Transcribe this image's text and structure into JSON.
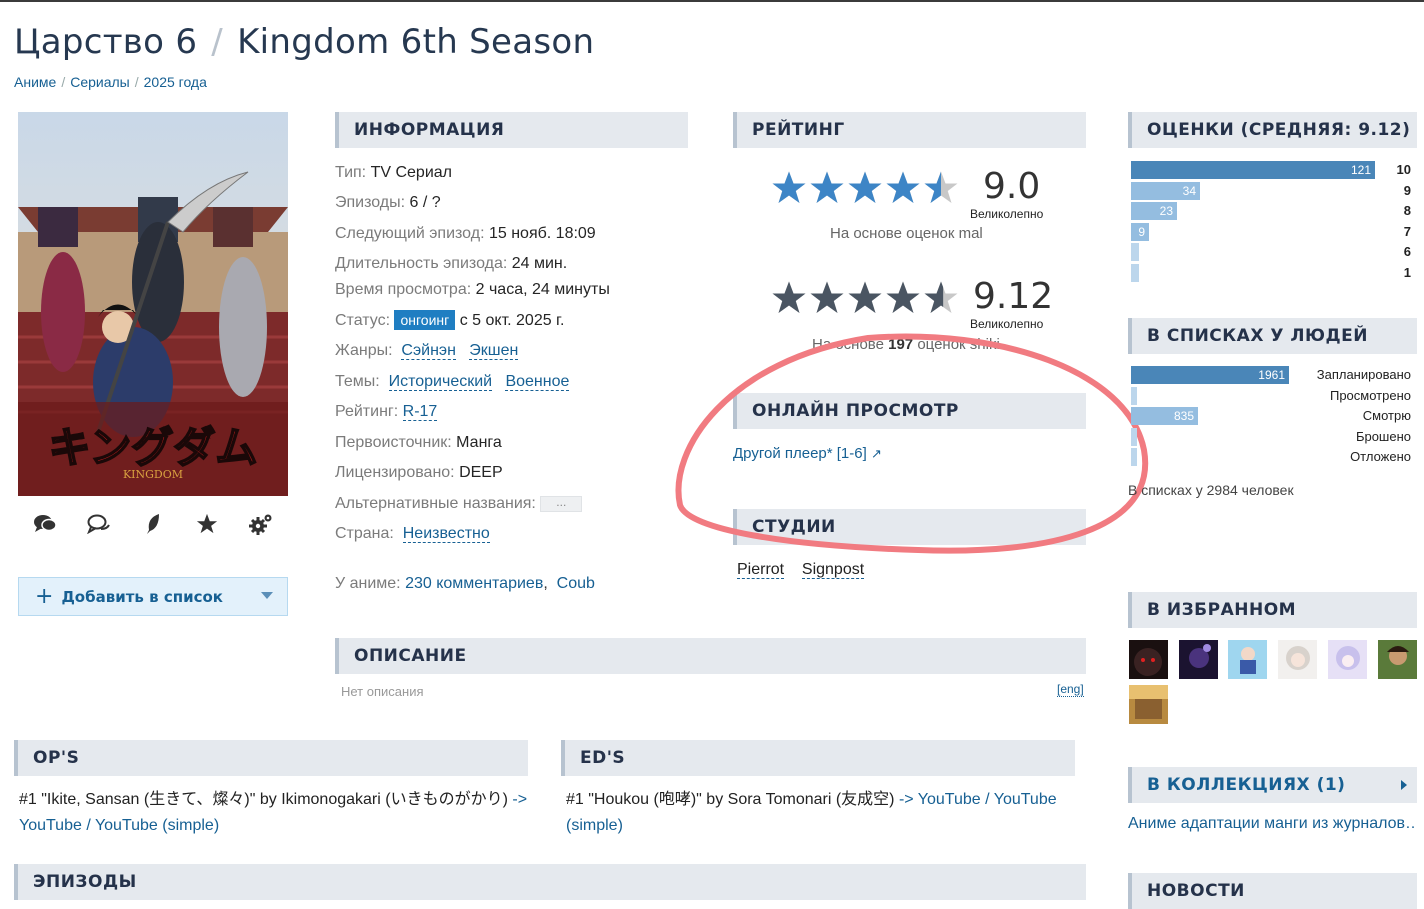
{
  "title": {
    "ru": "Царство 6",
    "separator": "/",
    "en": "Kingdom 6th Season"
  },
  "breadcrumbs": [
    "Аниме",
    "Сериалы",
    "2025 года"
  ],
  "poster": {
    "logo_text": "キングダム",
    "logo_sub": "KINGDOM"
  },
  "actions": {
    "add_to_list": "Добавить в список",
    "plus": "+"
  },
  "sections": {
    "info": "ИНФОРМАЦИЯ",
    "rating": "РЕЙТИНГ",
    "scores": "ОЦЕНКИ (СРЕДНЯЯ: 9.12)",
    "in_lists": "В СПИСКАХ У ЛЮДЕЙ",
    "online": "ОНЛАЙН ПРОСМОТР",
    "studios": "СТУДИИ",
    "favorites": "В ИЗБРАННОМ",
    "description": "ОПИСАНИЕ",
    "ops": "OP'S",
    "eds": "ED'S",
    "collections": "В КОЛЛЕКЦИЯХ (1)",
    "episodes": "ЭПИЗОДЫ",
    "news": "НОВОСТИ"
  },
  "info": {
    "type_k": "Тип:",
    "type_v": "TV Сериал",
    "episodes_k": "Эпизоды:",
    "episodes_v": "6 / ?",
    "next_k": "Следующий эпизод:",
    "next_v": "15 нояб. 18:09",
    "duration_k": "Длительность эпизода:",
    "duration_v": "24 мин.",
    "watch_k": "Время просмотра:",
    "watch_v": "2 часа, 24 минуты",
    "status_k": "Статус:",
    "status_badge": "онгоинг",
    "status_v": "с 5 окт. 2025 г.",
    "genres_k": "Жанры:",
    "genre1": "Сэйнэн",
    "genre2": "Экшен",
    "themes_k": "Темы:",
    "theme1": "Исторический",
    "theme2": "Военное",
    "rating_k": "Рейтинг:",
    "rating_v": "R-17",
    "source_k": "Первоисточник:",
    "source_v": "Манга",
    "license_k": "Лицензировано:",
    "license_v": "DEEP",
    "alt_k": "Альтернативные названия:",
    "alt_dots": "...",
    "country_k": "Страна:",
    "country_v": "Неизвестно",
    "about_k": "У аниме:",
    "comments": "230 комментариев",
    "comma": ",",
    "coub": "Coub"
  },
  "rating": {
    "mal_score": "9.0",
    "mal_fill": 0.9,
    "mal_label": "Великолепно",
    "mal_basis": "На основе оценок mal",
    "shiki_score": "9.12",
    "shiki_fill": 0.912,
    "shiki_label": "Великолепно",
    "shiki_basis_pre": "На основе",
    "shiki_count": "197",
    "shiki_basis_post": "оценок shiki"
  },
  "scores_bars": [
    {
      "label": "10",
      "value": 121,
      "text": "121"
    },
    {
      "label": "9",
      "value": 34,
      "text": "34"
    },
    {
      "label": "8",
      "value": 23,
      "text": "23"
    },
    {
      "label": "7",
      "value": 9,
      "text": "9"
    },
    {
      "label": "6",
      "value": 4,
      "text": ""
    },
    {
      "label": "1",
      "value": 4,
      "text": ""
    }
  ],
  "list_bars": [
    {
      "label": "Запланировано",
      "value": 1961,
      "text": "1961"
    },
    {
      "label": "Просмотрено",
      "value": 20,
      "text": ""
    },
    {
      "label": "Смотрю",
      "value": 835,
      "text": "835"
    },
    {
      "label": "Брошено",
      "value": 30,
      "text": ""
    },
    {
      "label": "Отложено",
      "value": 30,
      "text": ""
    }
  ],
  "in_lists_total": "В списках у 2984 человек",
  "online": {
    "link": "Другой плеер* [1-6]",
    "arrow": "↗"
  },
  "studios": [
    "Pierrot",
    "Signpost"
  ],
  "description": {
    "empty": "Нет описания",
    "lang": "[eng]"
  },
  "ops": {
    "line": "#1 \"Ikite, Sansan (生きて、燦々)\" by Ikimonogakari (いきものがかり)",
    "arrow": "->",
    "yt": "YouTube",
    "slash": "/",
    "yt_simple": "YouTube (simple)"
  },
  "eds": {
    "line": "#1 \"Houkou (咆哮)\" by Sora Tomonari (友成空)",
    "arrow": "->",
    "yt": "YouTube",
    "slash": "/",
    "yt_simple": "YouTube (simple)"
  },
  "collections": {
    "link": "Аниме адаптации манги из журналов…"
  },
  "colors": {
    "accent": "#176093",
    "bar": "#4a86b8",
    "badge": "#1f7ec2",
    "annotation": "#f17b81"
  },
  "icons": [
    "comments-icon",
    "discussion-icon",
    "feather-icon",
    "star-icon",
    "gears-icon"
  ]
}
